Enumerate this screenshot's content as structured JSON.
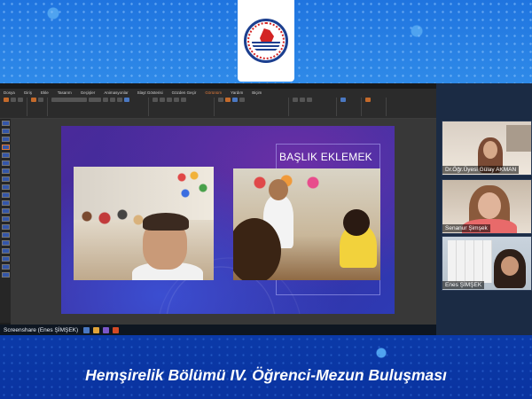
{
  "meeting": {
    "caption": "Hemşirelik Bölümü IV. Öğrenci-Mezun Buluşması",
    "screenshare_label": "Screenshare (Enes ŞİMŞEK)"
  },
  "app": {
    "menu": [
      "Dosya",
      "Giriş",
      "Ekle",
      "Tasarım",
      "Geçişler",
      "Animasyonlar",
      "Slayt Gösterisi",
      "Gözden Geçir",
      "Görünüm",
      "Yardım",
      "Biçim"
    ],
    "active_menu_index": 8
  },
  "slide": {
    "title": "BAŞLIK EKLEMEK"
  },
  "participants": [
    {
      "name": "Dr.Öğr.Üyesi Gülay AKMAN"
    },
    {
      "name": "Senanur Şimşek"
    },
    {
      "name": "Enes ŞİMŞEK"
    }
  ],
  "colors": {
    "brand_blue": "#1f74df",
    "accent_orange": "#e07a3a",
    "slide_purple": "#4a2a9a"
  }
}
